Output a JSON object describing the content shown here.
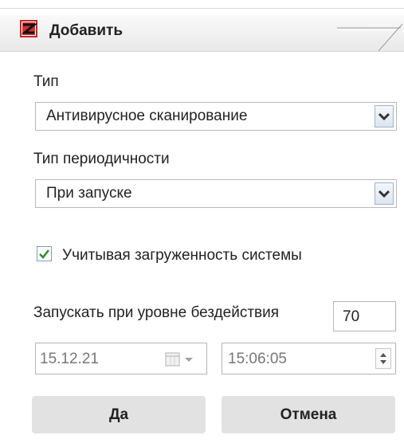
{
  "dialog": {
    "title": "Добавить",
    "icon": "app-logo-icon"
  },
  "type": {
    "label": "Тип",
    "value": "Антивирусное сканирование"
  },
  "periodicity": {
    "label": "Тип периодичности",
    "value": "При запуске"
  },
  "system_load": {
    "label": "Учитывая загруженность системы",
    "checked": true
  },
  "idle": {
    "label": "Запускать при уровне бездействия",
    "value": "70"
  },
  "date": {
    "value": "15.12.21",
    "icon": "calendar-icon"
  },
  "time": {
    "value": "15:06:05",
    "icon": "spinner-icon"
  },
  "buttons": {
    "ok": "Да",
    "cancel": "Отмена"
  },
  "colors": {
    "accent": "#d32f2f",
    "check": "#2a8a2a"
  }
}
